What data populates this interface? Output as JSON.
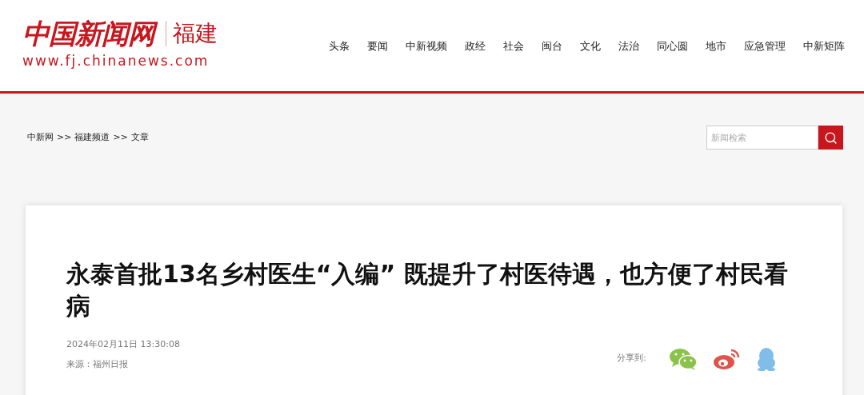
{
  "logo": {
    "name": "中国新闻网",
    "region": "福建",
    "url": "www.fj.chinanews.com"
  },
  "nav": [
    "头条",
    "要闻",
    "中新视频",
    "政经",
    "社会",
    "闽台",
    "文化",
    "法治",
    "同心圆",
    "地市",
    "应急管理",
    "中新矩阵"
  ],
  "breadcrumb": [
    {
      "label": "中新网",
      "separator": ">>"
    },
    {
      "label": "福建频道",
      "separator": ">>"
    },
    {
      "label": "文章"
    }
  ],
  "search": {
    "placeholder": "新闻检索"
  },
  "article": {
    "title": "永泰首批13名乡村医生“入编” 既提升了村医待遇，也方便了村民看病",
    "date": "2024年02月11日 13:30:08",
    "source": "来源：福州日报",
    "share_label": "分享到:",
    "share": [
      {
        "kind": "wechat"
      },
      {
        "kind": "weibo"
      },
      {
        "kind": "qq"
      }
    ]
  }
}
